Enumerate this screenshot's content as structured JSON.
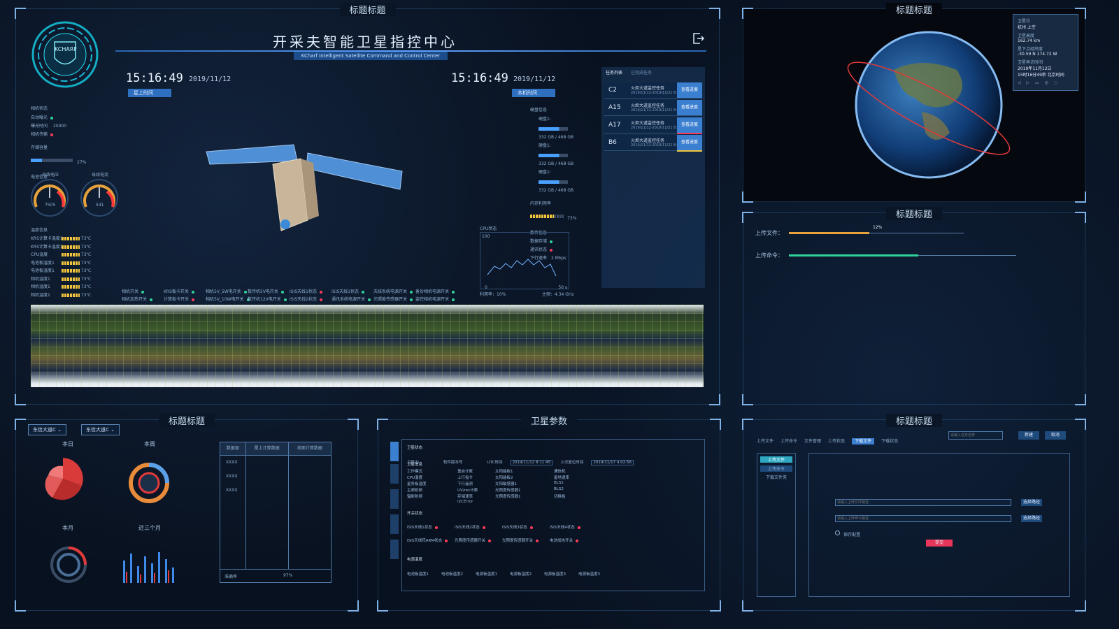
{
  "main": {
    "panel_title": "标题标题",
    "title": "开采夫智能卫星指控中心",
    "subtitle": "KCharf Intelligent Satellite Command and Control Center",
    "logo_text": "KCHARF",
    "star_time": "15:16:49",
    "star_date": "2019/11/12",
    "star_time_label": "星上时间",
    "local_time": "15:16:49",
    "local_date": "2019/11/12",
    "local_time_label": "本机时间",
    "left_info": {
      "camera_status": "相机状态",
      "camera_rows": [
        "自动曝光",
        "曝光时间",
        "相机传输"
      ],
      "exposure_value": "20000",
      "storage_label": "存储容量",
      "storage_pct": "27%",
      "storage_fill": 0.27,
      "battery_label": "电池信息",
      "gauge1_label": "母线电压",
      "gauge1_value": "7505",
      "gauge2_label": "母线电流",
      "gauge2_value": "541",
      "temp_label": "温度信息",
      "temps": [
        "KRS计算卡温度1",
        "KRS计算卡温度1",
        "CPU温度",
        "电池板温度1",
        "电池板温度1",
        "相机温度1",
        "相机温度1",
        "相机温度1"
      ],
      "temp_value": "73℃"
    },
    "right_info": {
      "disk_label": "硬盘信息",
      "disks": [
        "硬盘1:",
        "硬盘1:",
        "硬盘1:"
      ],
      "disk_value": "332 GB / 468 GB",
      "mem_label": "内存利用率",
      "mem_value": "73%",
      "mem_fill": 0.73,
      "net_label": "数传信息",
      "net_rows": [
        "数据存储",
        "通讯状态",
        "下行速率"
      ],
      "net_value3": "2 Mbps"
    },
    "switch_rows": [
      [
        "相机开关",
        "KRS板卡开关",
        "相机5V_5W电开关",
        "数传机5V电开关",
        "ISIS天线1状态",
        "ISIS天线1状态",
        "天线系统电源开关",
        "备份相机电源开关"
      ],
      [
        "相机加热开关",
        "计算板卡开关",
        "相机5V_10W电开关",
        "数传机12V电开关",
        "ISIS天线2状态",
        "通讯系统电源开关",
        "光照度传感器开关",
        "姿控相机电源开关"
      ]
    ],
    "cpu": {
      "label": "CPU状态",
      "ymax": "100",
      "y0": "0",
      "x_end": "50 s",
      "util_label": "利用率：",
      "util": "10%",
      "freq_label": "主频：",
      "freq": "4.34 GHz"
    },
    "task_tabs": [
      "任务列表",
      "已完成任务"
    ],
    "tasks": [
      {
        "code": "C2",
        "name": "火炬大道监控任务",
        "time": "2019/11/12-2019/11/21 8:11",
        "btn": "查看进度"
      },
      {
        "code": "A15",
        "name": "火炬大道监控任务",
        "time": "2019/11/12-2019/11/21 8:11",
        "btn": "查看进度"
      },
      {
        "code": "A17",
        "name": "火炬大道监控任务",
        "time": "2019/11/12-2019/11/21 8:11",
        "btn": "查看进度"
      },
      {
        "code": "B6",
        "name": "火炬大道监控任务",
        "time": "2019/11/12-2019/11/21 8:11",
        "btn": "查看进度"
      }
    ]
  },
  "globe": {
    "title": "标题标题",
    "info": [
      "卫星位",
      "杭州    上空",
      "卫星高度",
      "162.74    km",
      "星下点经纬度",
      "-30.59  N    174.72  W",
      "卫星再访时间",
      "2019年11月12日",
      "15时16分49秒    北京时间"
    ]
  },
  "timeline": {
    "title": "标题标题",
    "upload_file": "上传文件：",
    "upload_cmd": "上传命令：",
    "pct": "12%"
  },
  "stats": {
    "title": "标题标题",
    "dropdown1": "东信大道C",
    "dropdown2": "东信大道C",
    "today": "本日",
    "week": "本周",
    "month": "本月",
    "quarter": "近三个月",
    "table_headers": [
      "数据源",
      "星上计算数据",
      "地面计算数据"
    ],
    "table_rows": [
      "XXXX",
      "XXXX",
      "XXXX"
    ],
    "acc_label": "准确率",
    "acc_value": "97%"
  },
  "params": {
    "title": "卫星参数",
    "sections": [
      "卫星状态",
      "卫星信息",
      "开关状态",
      "电源温度"
    ],
    "state_row": [
      "卫星ID",
      "软件版本号",
      "UTC时间",
      "2019/11/12 8:11:45",
      "上次复位时间",
      "2019/11/17 4:02:56"
    ],
    "info_cols": [
      "工作模式",
      "CPU温度",
      "星务板温度",
      "主频射频",
      "辐射射频"
    ],
    "mid_cols": [
      "重启计数",
      "上行指令",
      "下行遥测",
      "UV/rec计数",
      "存储速率",
      "I2CError"
    ],
    "sensor_cols": [
      "太阳能板1",
      "太阳能板2",
      "太阳敏感器1",
      "光照度传感器1",
      "光照度传感器1"
    ],
    "power_cols": [
      "通信机",
      "星地速率",
      "BLS1",
      "BLS2",
      "切换板"
    ],
    "switch_items": [
      "ISIS天线1状态",
      "ISIS天线2状态",
      "ISIS天线3状态",
      "ISIS天线4状态",
      "ISIS天线阵ARM状态",
      "光照度传感器开关",
      "光照度传感器开关",
      "电池加热开关"
    ],
    "temp_items": [
      "电池板温度1",
      "电池板温度2",
      "电源板温度1",
      "电源板温度2",
      "电源板温度3",
      "电源板温度3"
    ]
  },
  "upload": {
    "title": "标题标题",
    "tabs": [
      "上传文件",
      "上传命令",
      "文件管理",
      "上传状态",
      "下载文件",
      "下载状态"
    ],
    "search_placeholder": "请输入任务名称",
    "new_btn": "新建",
    "cancel_btn": "取消",
    "side_items": [
      "上传文件",
      "上传命令",
      "下载文件夹"
    ],
    "field1": "请输入上传文件路径",
    "field2": "请输入上传命令路径",
    "browse": "选择路径",
    "radio_label": "保存配置",
    "submit": "提交"
  }
}
